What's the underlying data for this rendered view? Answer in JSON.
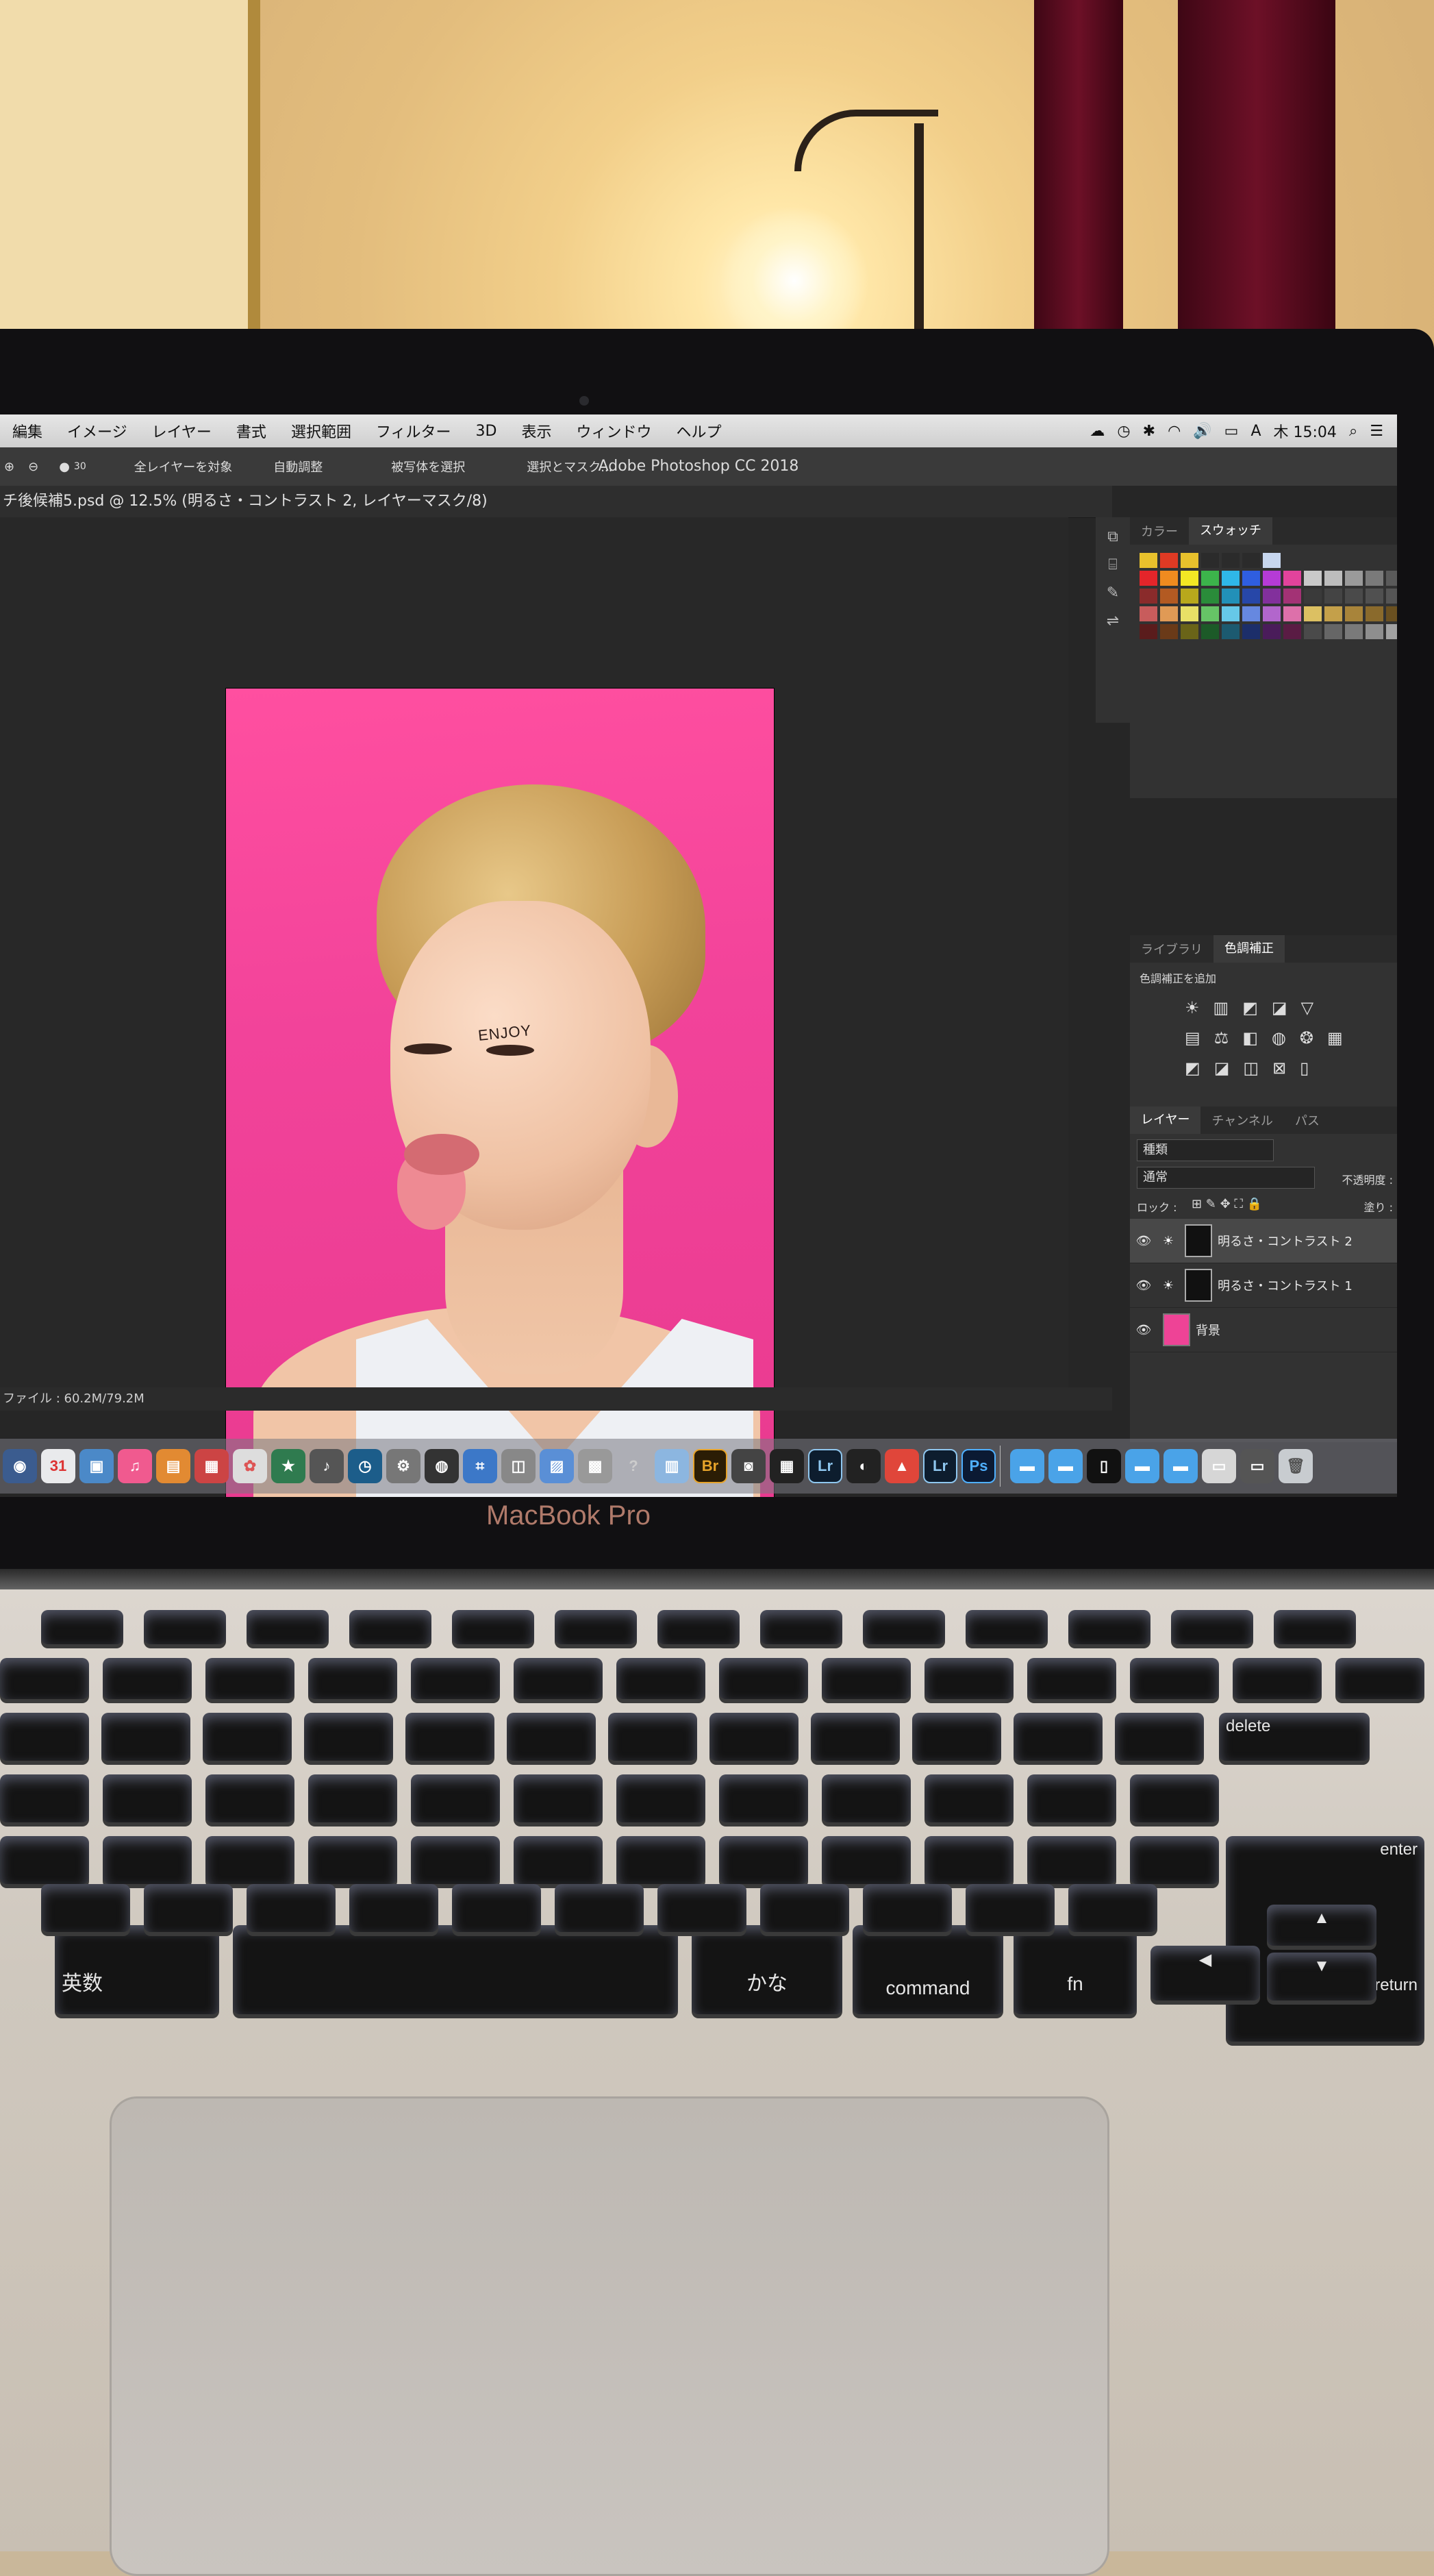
{
  "menubar": {
    "items": [
      "編集",
      "イメージ",
      "レイヤー",
      "書式",
      "選択範囲",
      "フィルター",
      "3D",
      "表示",
      "ウィンドウ",
      "ヘルプ"
    ],
    "clock": "木 15:04",
    "input_mode": "A"
  },
  "options_bar": {
    "brush_size": "30",
    "sample_all_layers": "全レイヤーを対象",
    "auto_adjust": "自動調整",
    "select_subject": "被写体を選択",
    "select_and_mask": "選択とマスク..."
  },
  "app_title": "Adobe Photoshop CC 2018",
  "document": {
    "tab_title": "チ後候補5.psd @ 12.5% (明るさ・コントラスト 2, レイヤーマスク/8)",
    "status": "ファイル : 60.2M/79.2M",
    "eye_text": "ENJOY"
  },
  "color_panel": {
    "tabs": [
      "カラー",
      "スウォッチ"
    ],
    "active_tab": "スウォッチ"
  },
  "adjust_panel": {
    "tabs": [
      "ライブラリ",
      "色調補正"
    ],
    "add_label": "色調補正を追加"
  },
  "layers_panel": {
    "tabs": [
      "レイヤー",
      "チャンネル",
      "パス"
    ],
    "filter_kind": "種類",
    "blend_mode": "通常",
    "opacity_label": "不透明度 :",
    "lock_label": "ロック :",
    "fill_label": "塗り :",
    "layers": [
      {
        "name": "明るさ・コントラスト 2",
        "selected": true
      },
      {
        "name": "明るさ・コントラスト 1",
        "selected": false
      },
      {
        "name": "背景",
        "selected": false
      }
    ]
  },
  "dock": {
    "apps": [
      "Br",
      "Lr",
      "Lr",
      "Ps"
    ]
  },
  "laptop": {
    "brand": "MacBook Pro"
  },
  "keyboard": {
    "delete": "delete",
    "enter": "enter",
    "return": "return",
    "eisu": "英数",
    "kana": "かな",
    "command": "command",
    "fn": "fn"
  },
  "colors": {
    "backdrop_pink": "#ee4396",
    "ps_panel": "#323232",
    "ps_canvas": "#282828"
  }
}
